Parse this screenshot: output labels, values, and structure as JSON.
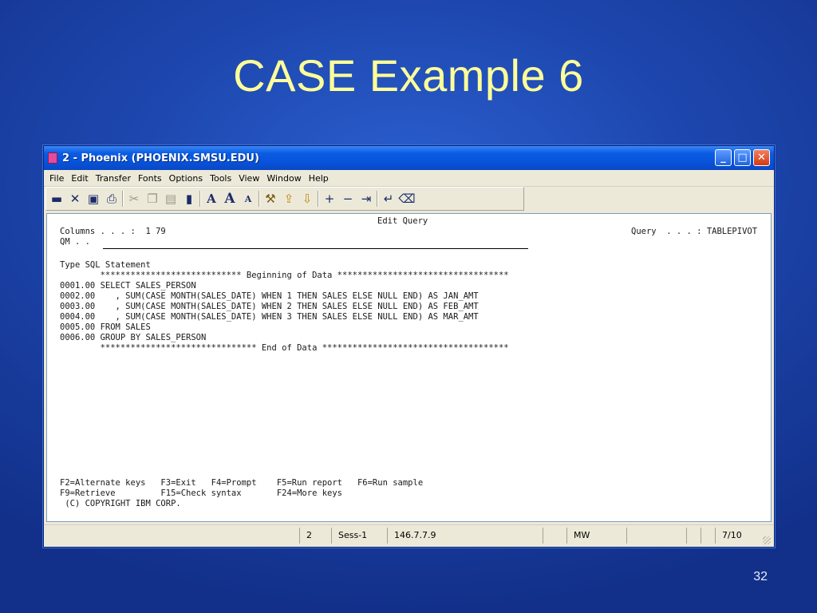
{
  "slide": {
    "title": "CASE Example 6",
    "page_number": "32"
  },
  "window": {
    "title": "2 - Phoenix (PHOENIX.SMSU.EDU)",
    "controls": {
      "minimize": "_",
      "maximize": "□",
      "close": "✕"
    }
  },
  "menu": [
    {
      "label": "File"
    },
    {
      "label": "Edit"
    },
    {
      "label": "Transfer"
    },
    {
      "label": "Fonts"
    },
    {
      "label": "Options"
    },
    {
      "label": "Tools"
    },
    {
      "label": "View"
    },
    {
      "label": "Window"
    },
    {
      "label": "Help"
    }
  ],
  "toolbar_icons": [
    "connect-icon",
    "disconnect-icon",
    "save-icon",
    "print-icon",
    "cut-icon",
    "copy-icon",
    "paste-icon",
    "lock-icon",
    "font-icon",
    "font-larger-icon",
    "font-smaller-icon",
    "tools-icon",
    "send-file-icon",
    "receive-file-icon",
    "plus-icon",
    "minus-icon",
    "tab-icon",
    "enter-icon",
    "erase-icon"
  ],
  "terminal": {
    "header": "Edit Query",
    "columns_line": "Columns . . . :  1 79",
    "query_line": "Query  . . . : TABLEPIVOT",
    "qm_line": "QM . .",
    "type_sql": "Type SQL Statement",
    "begin_data": "        **************************** Beginning of Data **********************************",
    "lines": [
      "0001.00 SELECT SALES_PERSON",
      "0002.00    , SUM(CASE MONTH(SALES_DATE) WHEN 1 THEN SALES ELSE NULL END) AS JAN_AMT",
      "0003.00    , SUM(CASE MONTH(SALES_DATE) WHEN 2 THEN SALES ELSE NULL END) AS FEB_AMT",
      "0004.00    , SUM(CASE MONTH(SALES_DATE) WHEN 3 THEN SALES ELSE NULL END) AS MAR_AMT",
      "0005.00 FROM SALES",
      "0006.00 GROUP BY SALES_PERSON"
    ],
    "end_data": "        ******************************* End of Data *************************************",
    "fkeys_1": "F2=Alternate keys   F3=Exit   F4=Prompt    F5=Run report   F6=Run sample",
    "fkeys_2": "F9=Retrieve         F15=Check syntax       F24=More keys",
    "copyright": " (C) COPYRIGHT IBM CORP."
  },
  "statusbar": {
    "session_number": "2",
    "session_name": "Sess-1",
    "host_ip": "146.7.7.9",
    "mode": "MW",
    "cursor_pos": "7/10"
  }
}
